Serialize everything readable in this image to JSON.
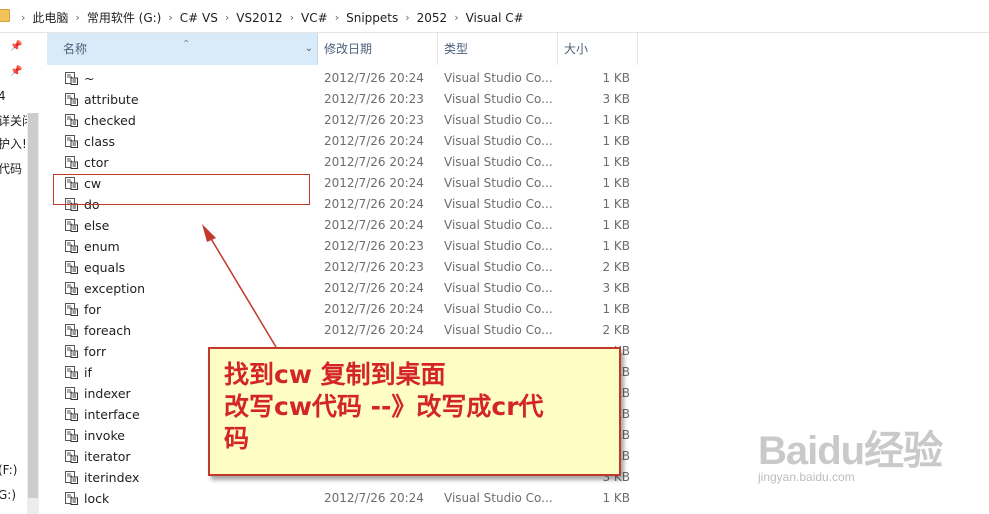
{
  "breadcrumb": [
    "此电脑",
    "常用软件 (G:)",
    "C# VS",
    "VS2012",
    "VC#",
    "Snippets",
    "2052",
    "Visual C#"
  ],
  "nav": {
    "items": [
      "4",
      "详关闭",
      "护入!",
      "代码",
      "(F:)",
      "G:)"
    ]
  },
  "columns": {
    "name": "名称",
    "date": "修改日期",
    "type": "类型",
    "size": "大小"
  },
  "files": [
    {
      "name": "~",
      "date": "2012/7/26 20:24",
      "type": "Visual Studio Co...",
      "size": "1 KB"
    },
    {
      "name": "attribute",
      "date": "2012/7/26 20:23",
      "type": "Visual Studio Co...",
      "size": "3 KB"
    },
    {
      "name": "checked",
      "date": "2012/7/26 20:23",
      "type": "Visual Studio Co...",
      "size": "1 KB"
    },
    {
      "name": "class",
      "date": "2012/7/26 20:24",
      "type": "Visual Studio Co...",
      "size": "1 KB"
    },
    {
      "name": "ctor",
      "date": "2012/7/26 20:24",
      "type": "Visual Studio Co...",
      "size": "1 KB"
    },
    {
      "name": "cw",
      "date": "2012/7/26 20:24",
      "type": "Visual Studio Co...",
      "size": "1 KB"
    },
    {
      "name": "do",
      "date": "2012/7/26 20:24",
      "type": "Visual Studio Co...",
      "size": "1 KB"
    },
    {
      "name": "else",
      "date": "2012/7/26 20:24",
      "type": "Visual Studio Co...",
      "size": "1 KB"
    },
    {
      "name": "enum",
      "date": "2012/7/26 20:23",
      "type": "Visual Studio Co...",
      "size": "1 KB"
    },
    {
      "name": "equals",
      "date": "2012/7/26 20:23",
      "type": "Visual Studio Co...",
      "size": "2 KB"
    },
    {
      "name": "exception",
      "date": "2012/7/26 20:24",
      "type": "Visual Studio Co...",
      "size": "3 KB"
    },
    {
      "name": "for",
      "date": "2012/7/26 20:24",
      "type": "Visual Studio Co...",
      "size": "1 KB"
    },
    {
      "name": "foreach",
      "date": "2012/7/26 20:24",
      "type": "Visual Studio Co...",
      "size": "2 KB"
    },
    {
      "name": "forr",
      "date": "",
      "type": "",
      "size": "KB"
    },
    {
      "name": "if",
      "date": "",
      "type": "",
      "size": "KB"
    },
    {
      "name": "indexer",
      "date": "",
      "type": "",
      "size": "KB"
    },
    {
      "name": "interface",
      "date": "",
      "type": "",
      "size": "KB"
    },
    {
      "name": "invoke",
      "date": "",
      "type": "",
      "size": "KB"
    },
    {
      "name": "iterator",
      "date": "",
      "type": "",
      "size": "KB"
    },
    {
      "name": "iterindex",
      "date": "",
      "type": "",
      "size": "3 KB"
    },
    {
      "name": "lock",
      "date": "2012/7/26 20:24",
      "type": "Visual Studio Co...",
      "size": "1 KB"
    }
  ],
  "callout": {
    "line1": "找到cw 复制到桌面",
    "line2": "改写cw代码 --》改写成cr代",
    "line3": "码"
  },
  "watermark": {
    "logo": "Baidu经验",
    "url": "jingyan.baidu.com"
  },
  "colors": {
    "annotation_red": "#c0392b",
    "callout_bg": "#fefdc4",
    "callout_text": "#d2242a",
    "header_selected": "#d9ebf9"
  }
}
